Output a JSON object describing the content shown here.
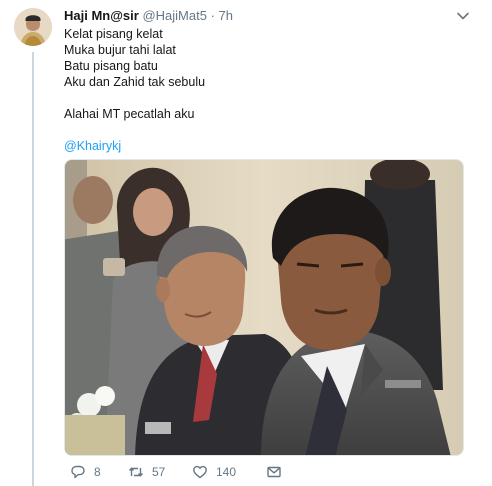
{
  "tweet": {
    "display_name": "Haji Mn@sir",
    "handle": "@HajiMat5",
    "separator": "·",
    "time": "7h",
    "lines": [
      "Kelat pisang kelat",
      "Muka bujur tahi lalat",
      "Batu pisang batu",
      "Aku dan Zahid tak sebulu",
      "",
      "Alahai MT pecatlah aku",
      "",
      "@Khairykj"
    ]
  },
  "actions": {
    "replies": "8",
    "retweets": "57",
    "likes": "140"
  },
  "icons": {
    "reply": "reply-icon",
    "retweet": "retweet-icon",
    "like": "heart-icon",
    "more": "chevron-down-icon",
    "share": "dm-icon"
  },
  "colors": {
    "link": "#1da1f2",
    "muted": "#657786",
    "thread_line": "#ccd6dd"
  }
}
